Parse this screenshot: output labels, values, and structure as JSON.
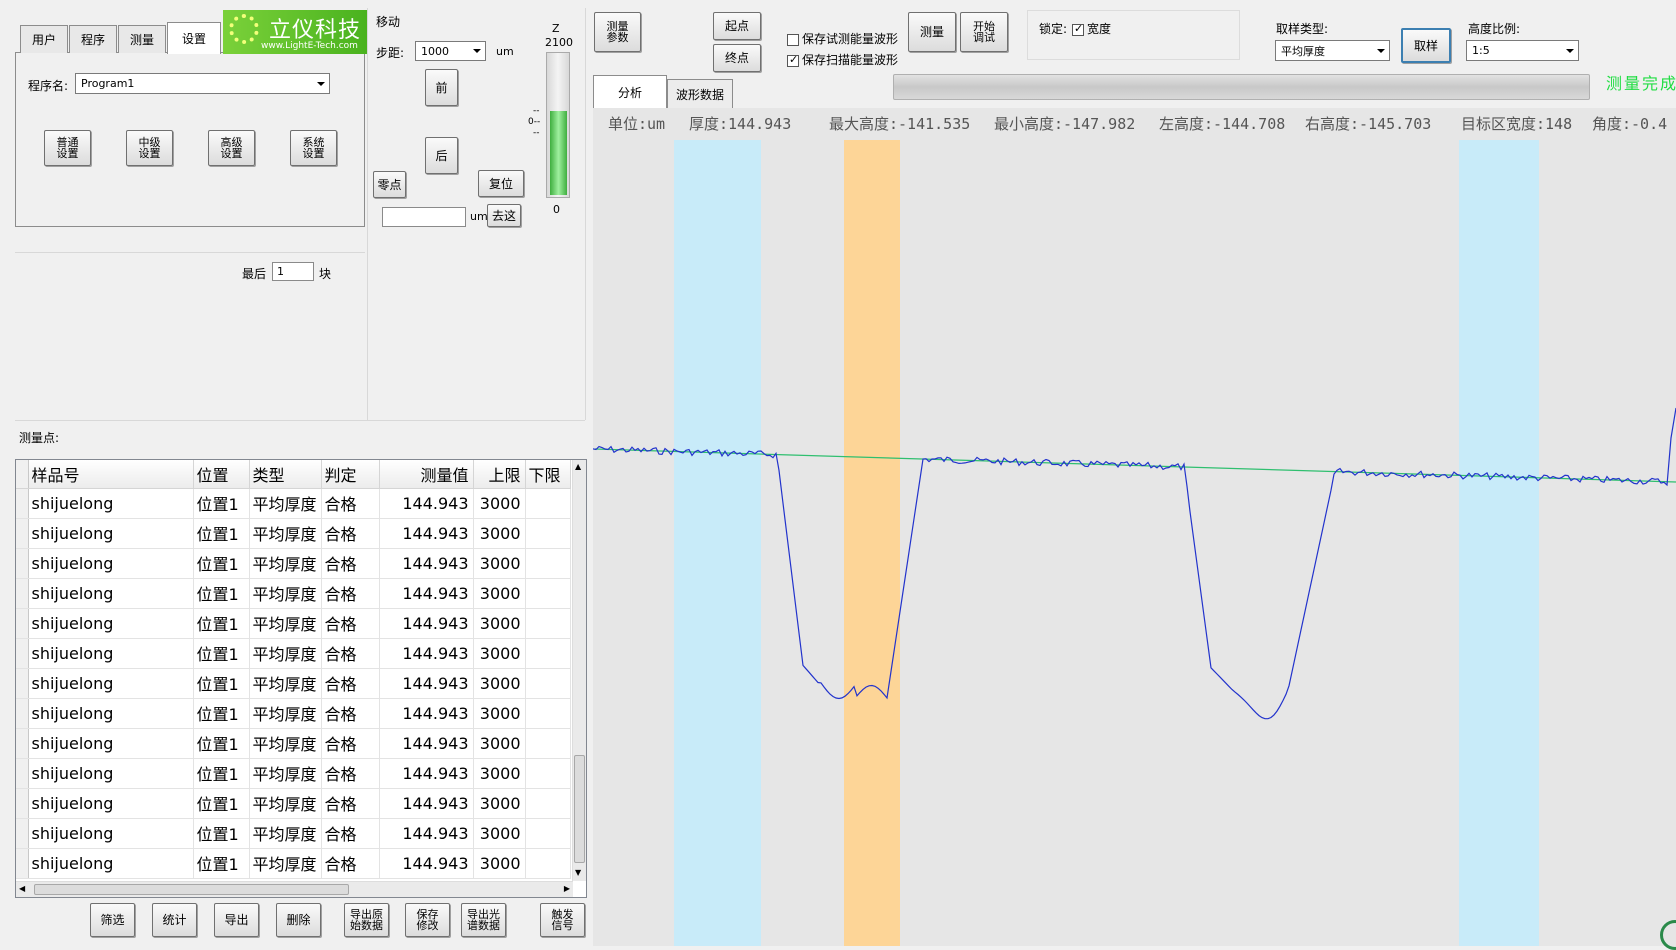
{
  "tabs": {
    "user": "用户",
    "program": "程序",
    "measure": "测量",
    "settings": "设置"
  },
  "logo": {
    "text": "立仪科技",
    "url": "www.LightE-Tech.com"
  },
  "program": {
    "label": "程序名:",
    "value": "Program1"
  },
  "settings_buttons": [
    "普通\n设置",
    "中级\n设置",
    "高级\n设置",
    "系统\n设置"
  ],
  "last_blocks": {
    "label": "最后",
    "value": "1",
    "unit": "块"
  },
  "move": {
    "title": "移动",
    "step_label": "步距:",
    "step_value": "1000",
    "step_unit": "um",
    "forward": "前",
    "back": "后",
    "zero": "零点",
    "reset": "复位",
    "goto_unit": "um",
    "goto": "去这",
    "z_label": "Z",
    "z_max": "2100",
    "z_min": "0",
    "z_level": 0.6,
    "z_mark_top": "--",
    "z_mark_mid": "0--",
    "z_mark_bot": "--"
  },
  "measure_points_label": "测量点:",
  "table": {
    "columns": [
      "样品号",
      "位置",
      "类型",
      "判定",
      "测量值",
      "上限",
      "下限"
    ],
    "rows": [
      [
        "shijuelong",
        "位置1",
        "平均厚度",
        "合格",
        "144.943",
        "3000",
        ""
      ],
      [
        "shijuelong",
        "位置1",
        "平均厚度",
        "合格",
        "144.943",
        "3000",
        ""
      ],
      [
        "shijuelong",
        "位置1",
        "平均厚度",
        "合格",
        "144.943",
        "3000",
        ""
      ],
      [
        "shijuelong",
        "位置1",
        "平均厚度",
        "合格",
        "144.943",
        "3000",
        ""
      ],
      [
        "shijuelong",
        "位置1",
        "平均厚度",
        "合格",
        "144.943",
        "3000",
        ""
      ],
      [
        "shijuelong",
        "位置1",
        "平均厚度",
        "合格",
        "144.943",
        "3000",
        ""
      ],
      [
        "shijuelong",
        "位置1",
        "平均厚度",
        "合格",
        "144.943",
        "3000",
        ""
      ],
      [
        "shijuelong",
        "位置1",
        "平均厚度",
        "合格",
        "144.943",
        "3000",
        ""
      ],
      [
        "shijuelong",
        "位置1",
        "平均厚度",
        "合格",
        "144.943",
        "3000",
        ""
      ],
      [
        "shijuelong",
        "位置1",
        "平均厚度",
        "合格",
        "144.943",
        "3000",
        ""
      ],
      [
        "shijuelong",
        "位置1",
        "平均厚度",
        "合格",
        "144.943",
        "3000",
        ""
      ],
      [
        "shijuelong",
        "位置1",
        "平均厚度",
        "合格",
        "144.943",
        "3000",
        ""
      ],
      [
        "shijuelong",
        "位置1",
        "平均厚度",
        "合格",
        "144.943",
        "3000",
        ""
      ]
    ]
  },
  "bottom_buttons": [
    "筛选",
    "统计",
    "导出",
    "删除",
    "导出原\n始数据",
    "保存\n修改",
    "导出光\n谱数据",
    "触发\n信号"
  ],
  "top": {
    "measure_params": "测量\n参数",
    "start_point": "起点",
    "end_point": "终点",
    "save_test_wave": "保存试测能量波形",
    "save_scan_wave": "保存扫描能量波形",
    "measure": "测量",
    "start_debug": "开始\n调试",
    "lock_label": "锁定:",
    "width_label": "宽度",
    "sample_type_label": "取样类型:",
    "sample_type_value": "平均厚度",
    "sample_button": "取样",
    "height_ratio_label": "高度比例:",
    "height_ratio_value": "1:5",
    "status": "测量完成",
    "tab_analysis": "分析",
    "tab_wave": "波形数据"
  },
  "stats": {
    "unit": "单位:um",
    "thickness": "厚度:144.943",
    "max_height": "最大高度:-141.535",
    "min_height": "最小高度:-147.982",
    "left_height": "左高度:-144.708",
    "right_height": "右高度:-145.703",
    "target_width": "目标区宽度:148",
    "angle": "角度:-0.4"
  },
  "colors": {
    "region_blue": "#c8ebf9",
    "region_orange": "#fdd597",
    "profile": "#2233cc",
    "baseline": "#2fbf6f",
    "status_green": "#22dd44"
  }
}
